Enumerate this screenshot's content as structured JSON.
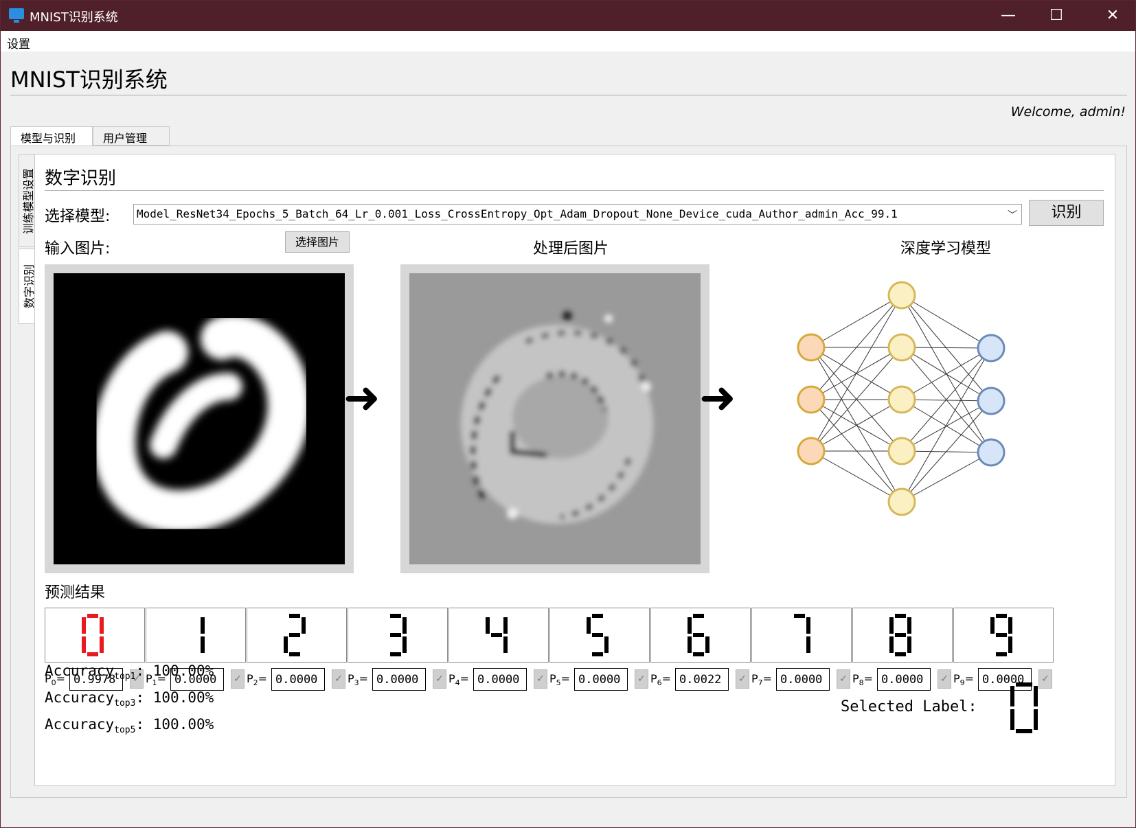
{
  "window": {
    "title": "MNIST识别系统",
    "controls": {
      "minimize": "—",
      "maximize": "☐",
      "close": "✕"
    }
  },
  "menu": {
    "items": [
      "设置"
    ]
  },
  "app": {
    "heading": "MNIST识别系统",
    "welcome": "Welcome, admin!"
  },
  "tabs": {
    "top": [
      "模型与识别",
      "用户管理"
    ],
    "side": [
      "训练模型设置",
      "数字识别"
    ]
  },
  "recognition": {
    "title": "数字识别",
    "model_label": "选择模型:",
    "model_value": "Model_ResNet34_Epochs_5_Batch_64_Lr_0.001_Loss_CrossEntropy_Opt_Adam_Dropout_None_Device_cuda_Author_admin_Acc_99.1",
    "recognize_button": "识别",
    "input_label": "输入图片:",
    "choose_image_button": "选择图片",
    "processed_label": "处理后图片",
    "model_graphic_label": "深度学习模型",
    "results_label": "预测结果"
  },
  "predictions": [
    {
      "digit": "0",
      "label": "P",
      "sub": "0",
      "value": "0.9978",
      "highlight": true
    },
    {
      "digit": "1",
      "label": "P",
      "sub": "1",
      "value": "0.0000",
      "highlight": false
    },
    {
      "digit": "2",
      "label": "P",
      "sub": "2",
      "value": "0.0000",
      "highlight": false
    },
    {
      "digit": "3",
      "label": "P",
      "sub": "3",
      "value": "0.0000",
      "highlight": false
    },
    {
      "digit": "4",
      "label": "P",
      "sub": "4",
      "value": "0.0000",
      "highlight": false
    },
    {
      "digit": "5",
      "label": "P",
      "sub": "5",
      "value": "0.0000",
      "highlight": false
    },
    {
      "digit": "6",
      "label": "P",
      "sub": "6",
      "value": "0.0022",
      "highlight": false
    },
    {
      "digit": "7",
      "label": "P",
      "sub": "7",
      "value": "0.0000",
      "highlight": false
    },
    {
      "digit": "8",
      "label": "P",
      "sub": "8",
      "value": "0.0000",
      "highlight": false
    },
    {
      "digit": "9",
      "label": "P",
      "sub": "9",
      "value": "0.0000",
      "highlight": false
    }
  ],
  "accuracy": [
    {
      "label": "Accuracy",
      "sub": "top1",
      "value": "100.00%"
    },
    {
      "label": "Accuracy",
      "sub": "top3",
      "value": "100.00%"
    },
    {
      "label": "Accuracy",
      "sub": "top5",
      "value": "100.00%"
    }
  ],
  "selected": {
    "label": "Selected Label:",
    "digit": "0"
  },
  "colors": {
    "titlebar": "#4f1f2a",
    "highlight_digit": "#e8191f",
    "normal_digit": "#000000",
    "input_neuron": "#fbd9b8",
    "hidden_neuron": "#fbf0c3",
    "output_neuron": "#d7e5f8"
  }
}
